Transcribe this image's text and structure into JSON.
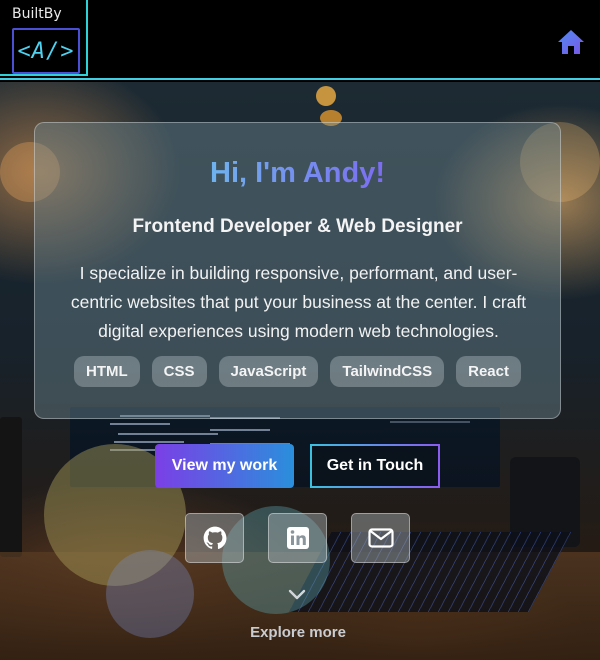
{
  "header": {
    "logo_top": "BuiltBy",
    "logo_mark": "<A/>",
    "home_icon": "home-icon"
  },
  "hero": {
    "greeting": "Hi, I'm Andy!",
    "role": "Frontend Developer & Web Designer",
    "bio": "I specialize in building responsive, performant, and user-centric websites that put your business at the center. I craft digital experiences using modern web technologies.",
    "tags": [
      "HTML",
      "CSS",
      "JavaScript",
      "TailwindCSS",
      "React"
    ],
    "primary_cta": "View my work",
    "secondary_cta": "Get in Touch",
    "social": [
      {
        "name": "github",
        "icon": "github-icon"
      },
      {
        "name": "linkedin",
        "icon": "linkedin-icon"
      },
      {
        "name": "email",
        "icon": "mail-icon"
      }
    ],
    "explore_label": "Explore more"
  },
  "colors": {
    "accent_cyan": "#3fd0e6",
    "accent_purple": "#7b3fe6",
    "accent_blue": "#2a8fdc",
    "header_bg": "#000000"
  }
}
